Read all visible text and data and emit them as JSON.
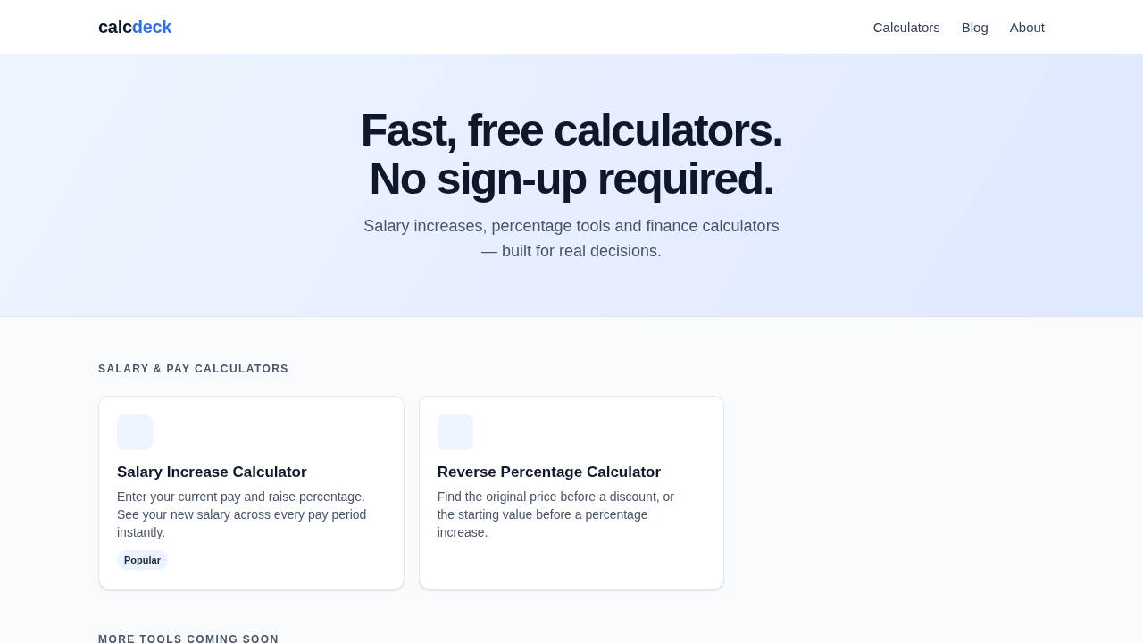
{
  "header": {
    "logo": {
      "main": "calc",
      "accent": "deck"
    },
    "nav": [
      {
        "label": "Calculators"
      },
      {
        "label": "Blog"
      },
      {
        "label": "About"
      }
    ]
  },
  "hero": {
    "title": "Fast, free calculators. No sign-up required.",
    "subtitle": "Salary increases, percentage tools and finance calculators — built for real decisions."
  },
  "sections": [
    {
      "heading": "SALARY & PAY CALCULATORS",
      "cards": [
        {
          "title": "Salary Increase Calculator",
          "description": "Enter your current pay and raise percentage. See your new salary across every pay period instantly.",
          "badge": "Popular"
        },
        {
          "title": "Reverse Percentage Calculator",
          "description": "Find the original price before a discount, or the starting value before a percentage increase."
        }
      ]
    },
    {
      "heading": "MORE TOOLS COMING SOON"
    }
  ]
}
